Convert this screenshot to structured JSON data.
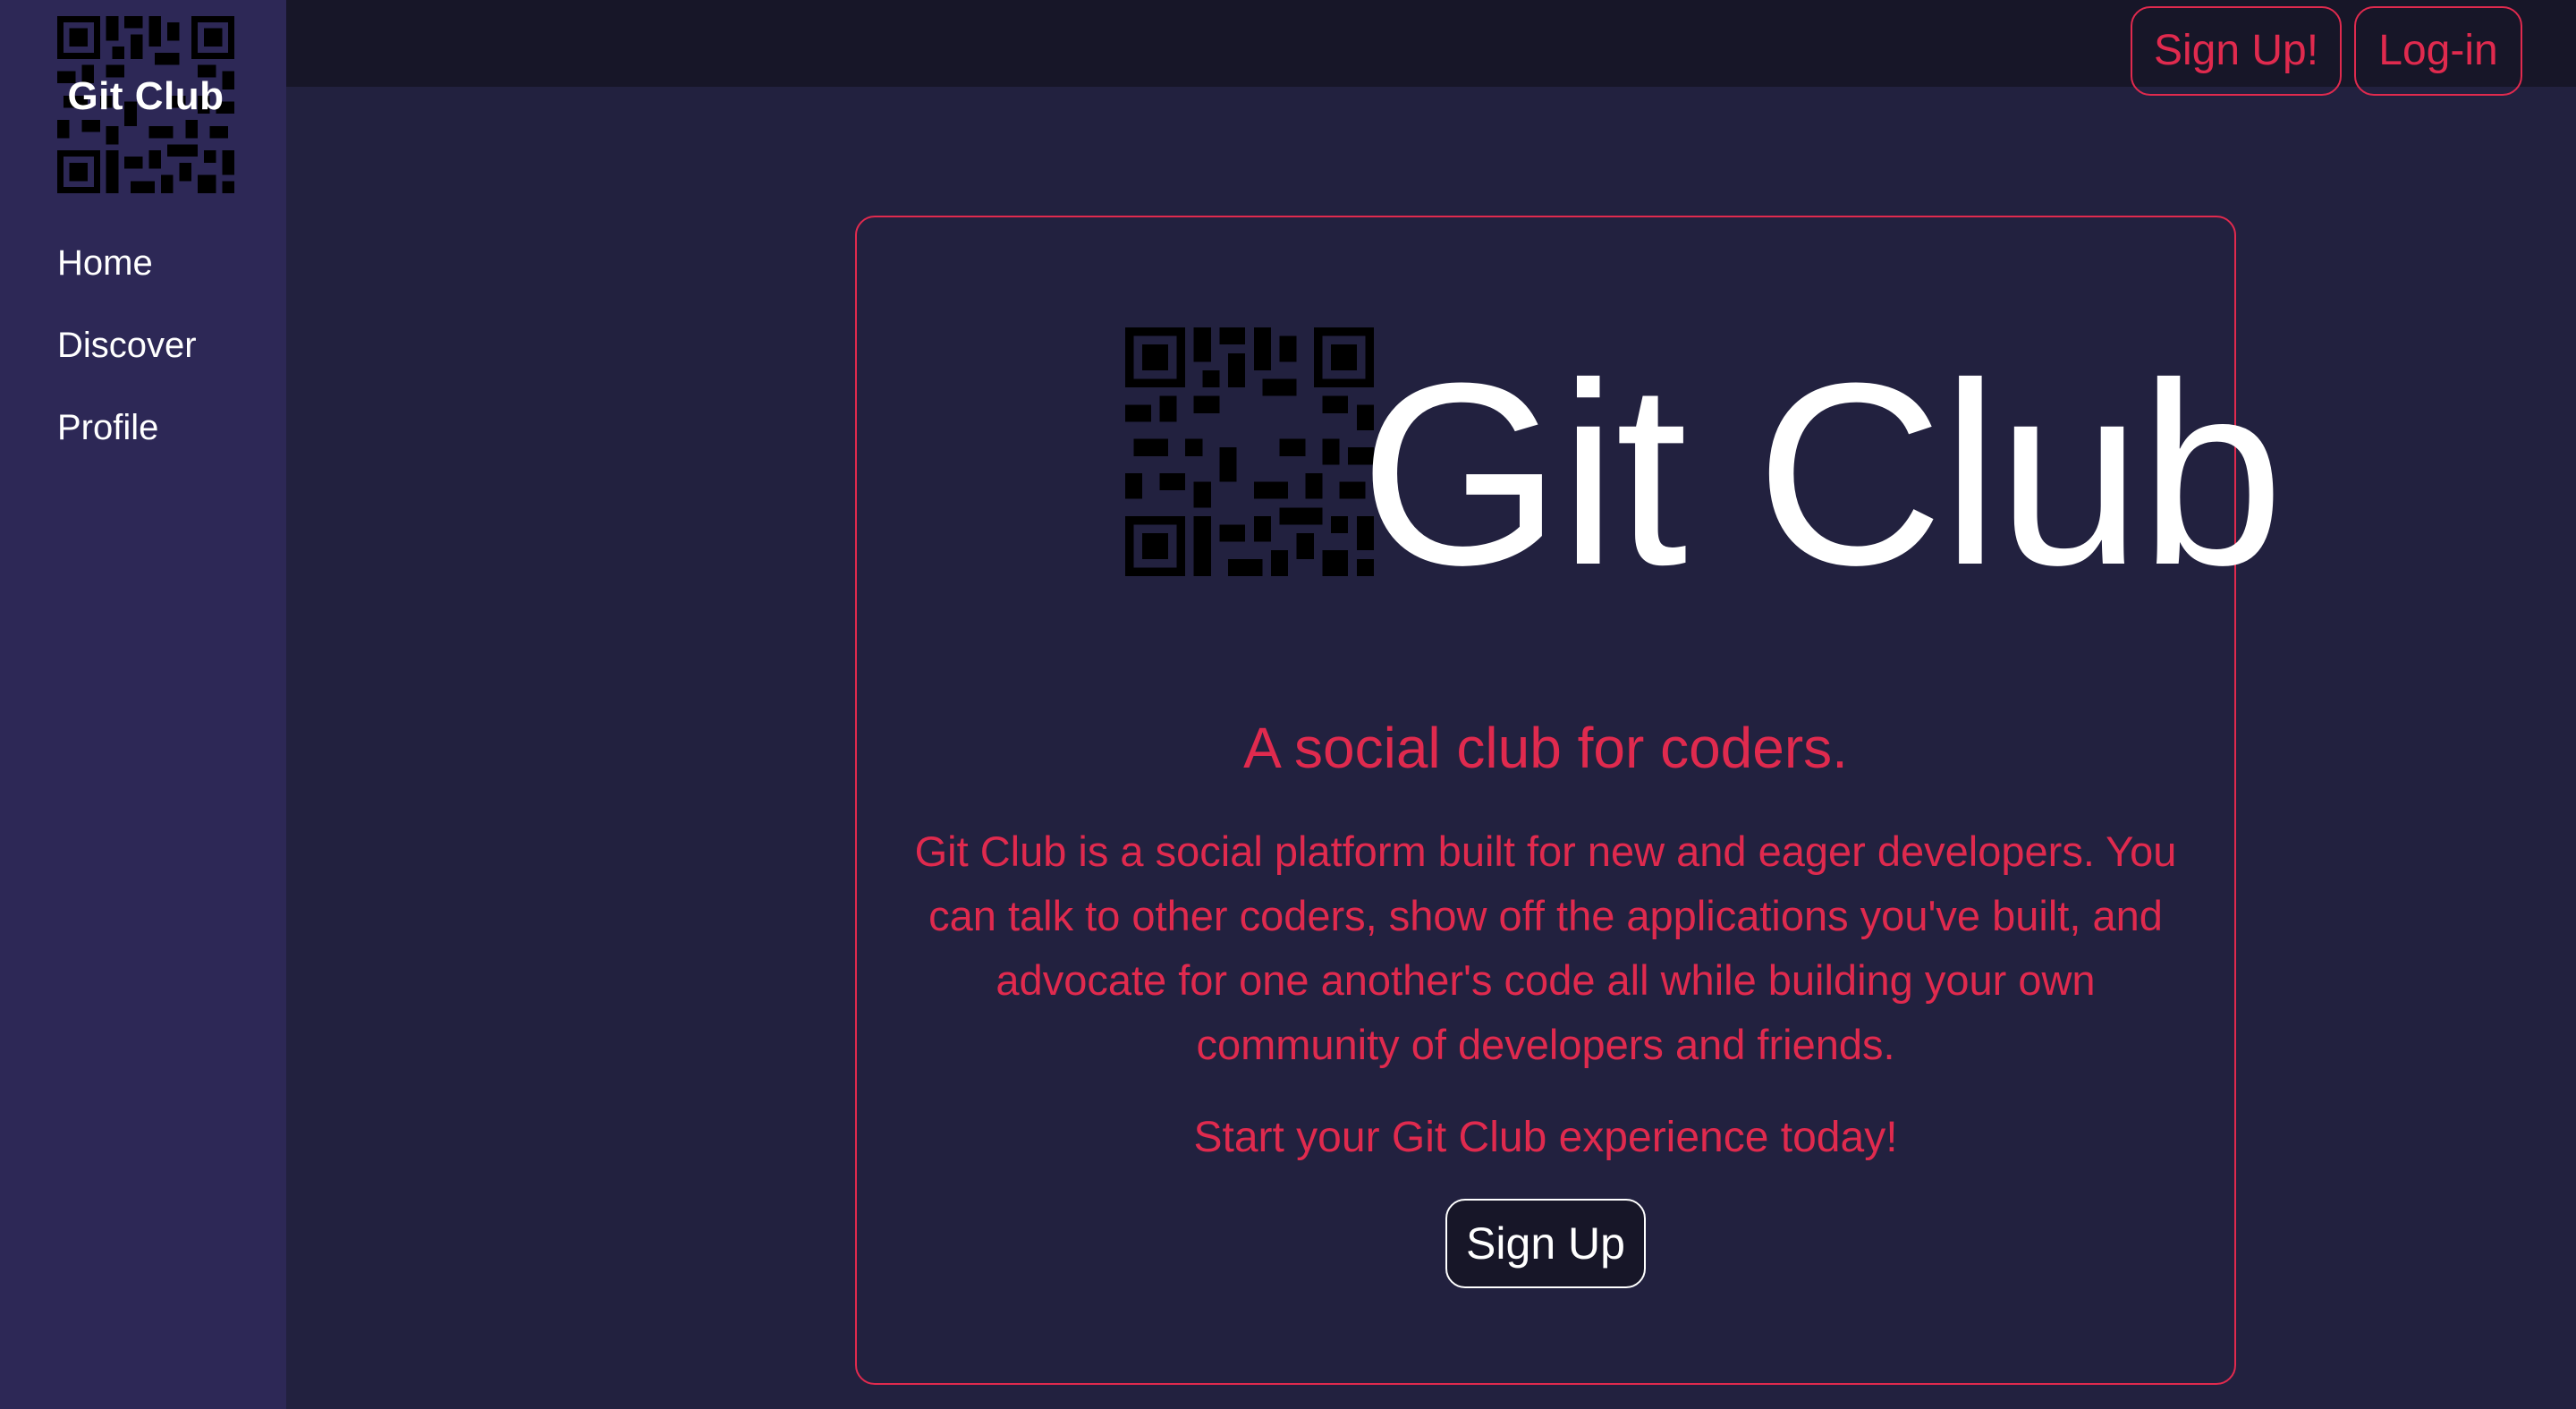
{
  "app": {
    "name": "Git Club",
    "colors": {
      "sidebar_bg": "#2d2856",
      "page_bg": "#22213f",
      "topbar_bg": "#171628",
      "accent": "#e02a4e",
      "text_light": "#ffffff"
    }
  },
  "sidebar": {
    "logo_icon": "qr-code-logo-icon",
    "logo_text": "Git Club",
    "items": [
      {
        "label": "Home"
      },
      {
        "label": "Discover"
      },
      {
        "label": "Profile"
      }
    ]
  },
  "topbar": {
    "signup_label": "Sign Up!",
    "login_label": "Log-in"
  },
  "hero": {
    "logo_icon": "qr-code-logo-icon",
    "title": "Git Club",
    "tagline": "A social club for coders.",
    "description": "Git Club is a social platform built for new and eager developers. You can talk to other coders, show off the applications you've built, and advocate for one another's code all while building your own community of developers and friends.",
    "cta_text": "Start your Git Club experience today!",
    "cta_button": "Sign Up"
  }
}
